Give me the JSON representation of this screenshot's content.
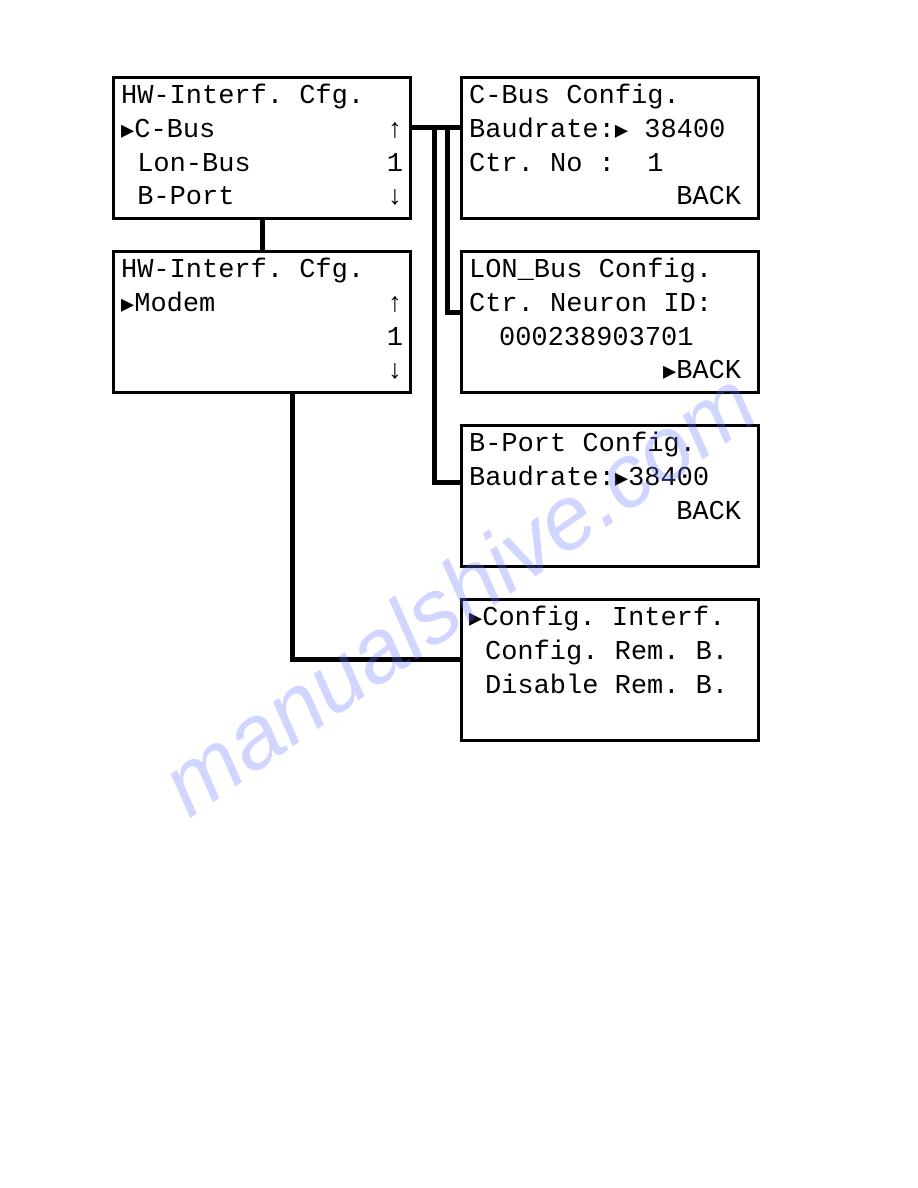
{
  "watermark": "manualshive.com",
  "box1": {
    "title": "HW-Interf. Cfg.",
    "lines": [
      {
        "label": "C-Bus",
        "cursor": true,
        "right": "↑"
      },
      {
        "label": "Lon-Bus",
        "cursor": false,
        "right": "1"
      },
      {
        "label": "B-Port",
        "cursor": false,
        "right": "↓"
      }
    ]
  },
  "box2": {
    "title": "HW-Interf. Cfg.",
    "lines": [
      {
        "label": "Modem",
        "cursor": true,
        "right": "↑"
      },
      {
        "label": "",
        "cursor": false,
        "right": "1"
      },
      {
        "label": "",
        "cursor": false,
        "right": "↓"
      }
    ]
  },
  "box_cbus": {
    "title": "C-Bus Config.",
    "l1_label": "Baudrate:",
    "l1_val": "38400",
    "l2_label": "Ctr. No :",
    "l2_val": "1",
    "back": "BACK"
  },
  "box_lon": {
    "title": "LON_Bus Config.",
    "l1": "Ctr. Neuron ID:",
    "l2": "000238903701",
    "back": "BACK"
  },
  "box_bport": {
    "title": "B-Port Config.",
    "l1_label": "Baudrate:",
    "l1_val": "38400",
    "back": "BACK"
  },
  "box_modem": {
    "l1": "Config. Interf.",
    "l3": "Config. Rem. B.",
    "l4": "Disable Rem. B."
  }
}
